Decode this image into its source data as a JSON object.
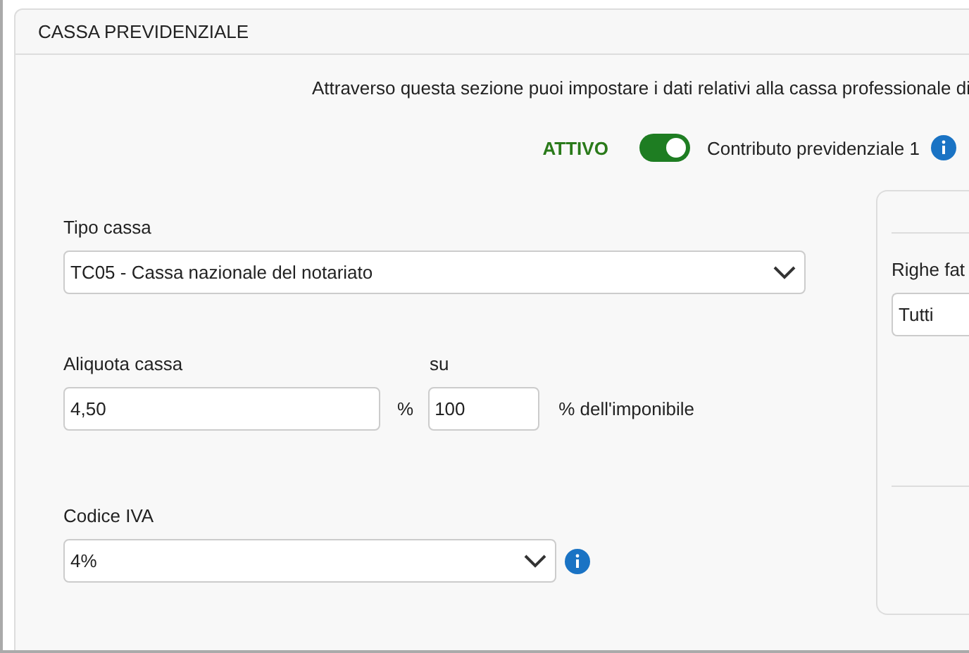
{
  "panel": {
    "title": "CASSA PREVIDENZIALE"
  },
  "description": "Attraverso questa sezione puoi impostare i dati relativi alla cassa professionale di",
  "status": {
    "label": "ATTIVO",
    "on": true,
    "toggle_label": "Contributo previdenziale 1"
  },
  "tipo_cassa": {
    "label": "Tipo cassa",
    "value": "TC05 - Cassa nazionale del notariato"
  },
  "aliquota": {
    "label": "Aliquota cassa",
    "value": "4,50",
    "unit": "%"
  },
  "base": {
    "label": "su",
    "value": "100",
    "suffix": "% dell'imponibile"
  },
  "codice_iva": {
    "label": "Codice IVA",
    "value": "4%"
  },
  "side_panel": {
    "label": "Righe fat",
    "value": "Tutti"
  }
}
